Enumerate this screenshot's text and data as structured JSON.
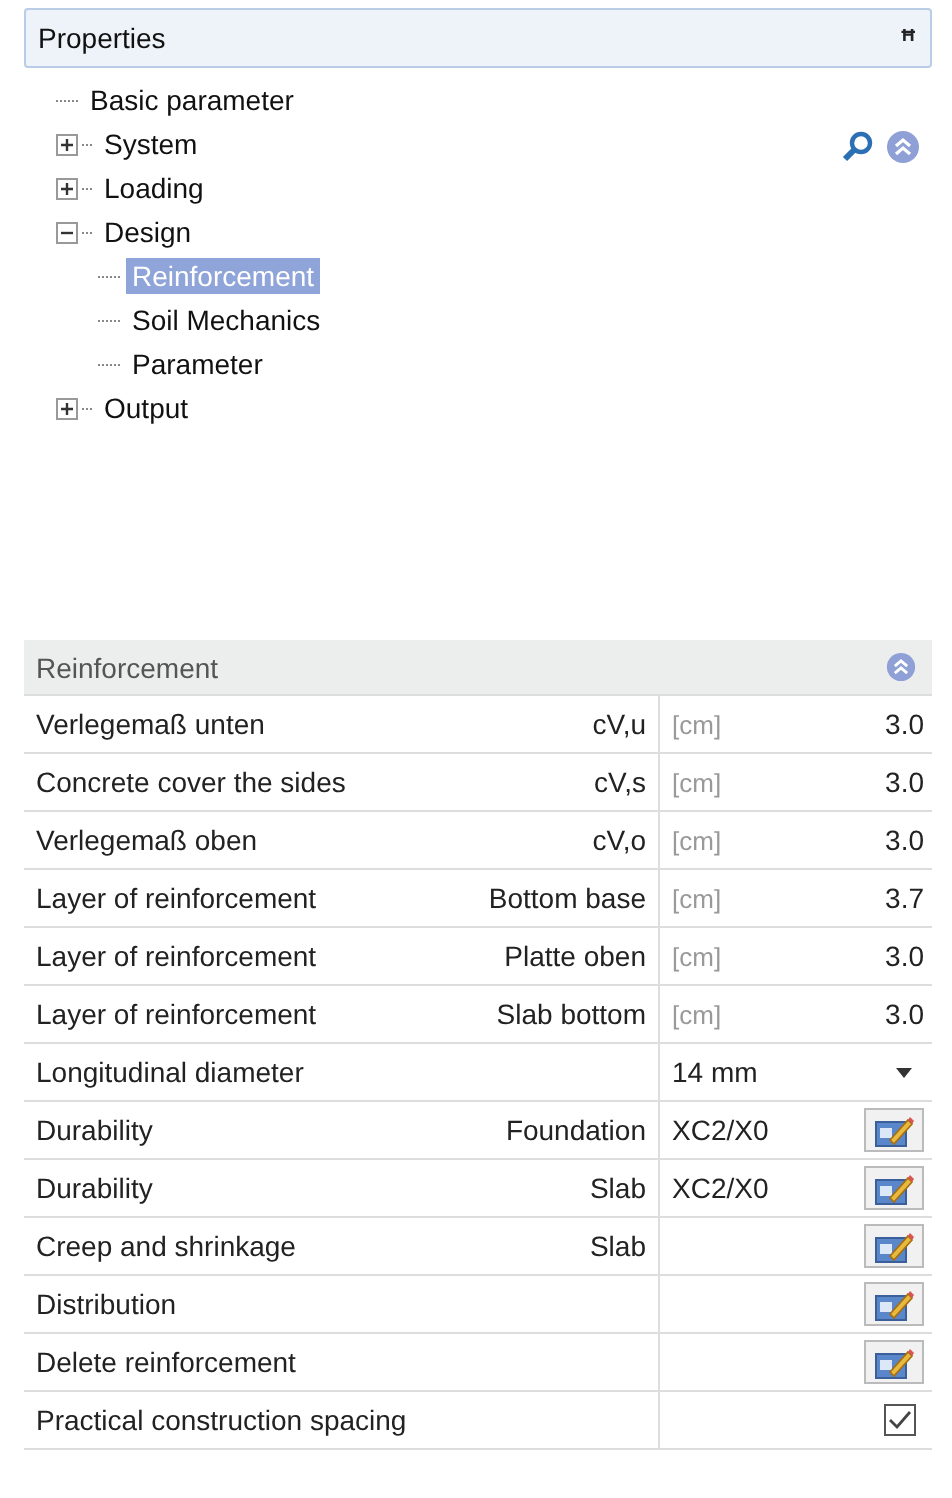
{
  "panel": {
    "title": "Properties",
    "pin_glyph": "ꟸ"
  },
  "tree": [
    {
      "label": "Basic parameter",
      "selected": false
    },
    {
      "label": "System",
      "selected": false,
      "expanded": false
    },
    {
      "label": "Loading",
      "selected": false,
      "expanded": false
    },
    {
      "label": "Design",
      "selected": false,
      "expanded": true,
      "children": [
        {
          "label": "Reinforcement",
          "selected": true
        },
        {
          "label": "Soil Mechanics",
          "selected": false
        },
        {
          "label": "Parameter",
          "selected": false
        }
      ]
    },
    {
      "label": "Output",
      "selected": false,
      "expanded": false
    }
  ],
  "section": {
    "title": "Reinforcement"
  },
  "rows": [
    {
      "kind": "value",
      "label": "Verlegemaß unten",
      "qualifier": "cV,u",
      "unit": "[cm]",
      "value": "3.0"
    },
    {
      "kind": "value",
      "label": "Concrete cover the sides",
      "qualifier": "cV,s",
      "unit": "[cm]",
      "value": "3.0"
    },
    {
      "kind": "value",
      "label": "Verlegemaß oben",
      "qualifier": "cV,o",
      "unit": "[cm]",
      "value": "3.0"
    },
    {
      "kind": "value",
      "label": "Layer of reinforcement",
      "qualifier": "Bottom base",
      "unit": "[cm]",
      "value": "3.7"
    },
    {
      "kind": "value",
      "label": "Layer of reinforcement",
      "qualifier": "Platte oben",
      "unit": "[cm]",
      "value": "3.0"
    },
    {
      "kind": "value",
      "label": "Layer of reinforcement",
      "qualifier": "Slab bottom",
      "unit": "[cm]",
      "value": "3.0"
    },
    {
      "kind": "dropdown",
      "label": "Longitudinal diameter",
      "value": "14 mm"
    },
    {
      "kind": "edit",
      "label": "Durability",
      "qualifier": "Foundation",
      "value": "XC2/X0"
    },
    {
      "kind": "edit",
      "label": "Durability",
      "qualifier": "Slab",
      "value": "XC2/X0"
    },
    {
      "kind": "edit",
      "label": "Creep and shrinkage",
      "qualifier": "Slab"
    },
    {
      "kind": "edit",
      "label": "Distribution"
    },
    {
      "kind": "edit",
      "label": "Delete reinforcement"
    },
    {
      "kind": "checkbox",
      "label": "Practical construction spacing",
      "checked": true
    }
  ]
}
